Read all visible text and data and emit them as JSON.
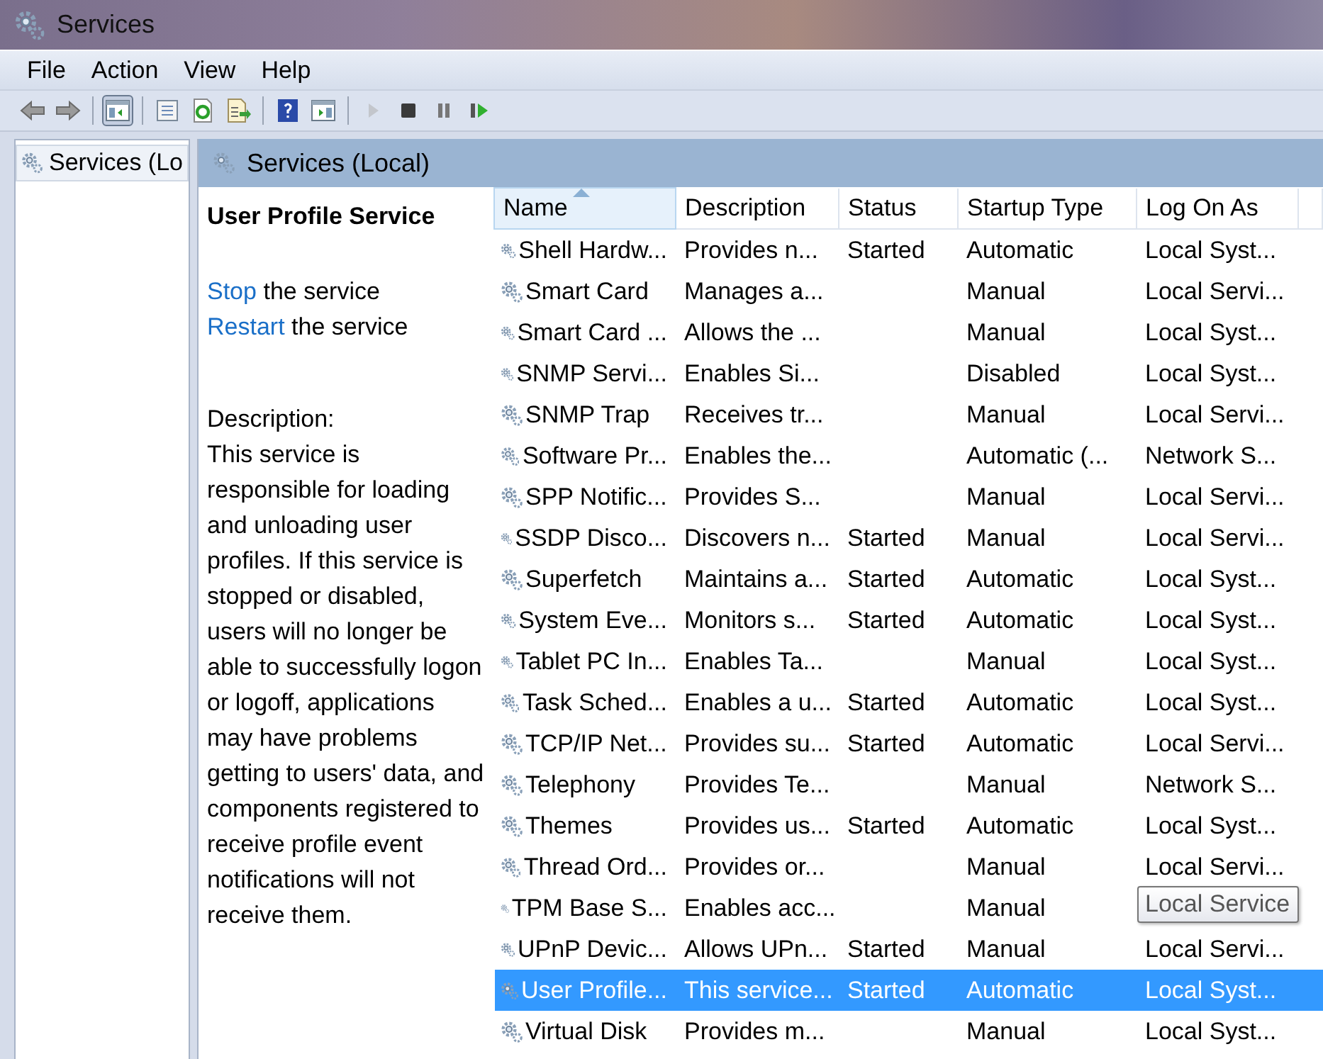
{
  "window": {
    "title": "Services"
  },
  "menu": [
    "File",
    "Action",
    "View",
    "Help"
  ],
  "toolbar": [
    {
      "kind": "back",
      "disabled": false
    },
    {
      "kind": "forward",
      "disabled": false
    },
    {
      "kind": "sep"
    },
    {
      "kind": "tree",
      "pressed": true
    },
    {
      "kind": "sep"
    },
    {
      "kind": "properties"
    },
    {
      "kind": "refresh"
    },
    {
      "kind": "export"
    },
    {
      "kind": "sep"
    },
    {
      "kind": "help"
    },
    {
      "kind": "pane"
    },
    {
      "kind": "sep"
    },
    {
      "kind": "play",
      "disabled": true
    },
    {
      "kind": "stop",
      "disabled": false
    },
    {
      "kind": "pause",
      "disabled": false
    },
    {
      "kind": "resume",
      "disabled": false
    }
  ],
  "tree": {
    "items": [
      {
        "label": "Services (Lo",
        "selected": true
      }
    ]
  },
  "panel_title": "Services (Local)",
  "details": {
    "title": "User Profile Service",
    "actions": [
      {
        "link": "Stop",
        "text": "the service"
      },
      {
        "link": "Restart",
        "text": "the service"
      }
    ],
    "description_label": "Description:",
    "description": "This service is responsible for loading and unloading user profiles. If this service is stopped or disabled, users will no longer be able to successfully logon or logoff, applications may have problems getting to users' data, and components registered to receive profile event notifications will not receive them."
  },
  "table": {
    "columns": [
      {
        "label": "Name",
        "sorted": true
      },
      {
        "label": "Description",
        "sorted": false
      },
      {
        "label": "Status",
        "sorted": false
      },
      {
        "label": "Startup Type",
        "sorted": false
      },
      {
        "label": "Log On As",
        "sorted": false
      }
    ],
    "rows": [
      {
        "name": "Shell Hardw...",
        "description": "Provides n...",
        "status": "Started",
        "startup": "Automatic",
        "logon": "Local Syst...",
        "selected": false
      },
      {
        "name": "Smart Card",
        "description": "Manages a...",
        "startup": "Manual",
        "logon": "Local Servi...",
        "selected": false
      },
      {
        "name": "Smart Card ...",
        "description": "Allows the ...",
        "startup": "Manual",
        "logon": "Local Syst...",
        "selected": false
      },
      {
        "name": "SNMP Servi...",
        "description": "Enables Si...",
        "startup": "Disabled",
        "logon": "Local Syst...",
        "selected": false
      },
      {
        "name": "SNMP Trap",
        "description": "Receives tr...",
        "startup": "Manual",
        "logon": "Local Servi...",
        "selected": false
      },
      {
        "name": "Software Pr...",
        "description": "Enables the...",
        "startup": "Automatic (...",
        "logon": "Network S...",
        "selected": false
      },
      {
        "name": "SPP Notific...",
        "description": "Provides S...",
        "startup": "Manual",
        "logon": "Local Servi...",
        "selected": false
      },
      {
        "name": "SSDP Disco...",
        "description": "Discovers n...",
        "status": "Started",
        "startup": "Manual",
        "logon": "Local Servi...",
        "selected": false
      },
      {
        "name": "Superfetch",
        "description": "Maintains a...",
        "status": "Started",
        "startup": "Automatic",
        "logon": "Local Syst...",
        "selected": false
      },
      {
        "name": "System Eve...",
        "description": "Monitors s...",
        "status": "Started",
        "startup": "Automatic",
        "logon": "Local Syst...",
        "selected": false
      },
      {
        "name": "Tablet PC In...",
        "description": "Enables Ta...",
        "startup": "Manual",
        "logon": "Local Syst...",
        "selected": false
      },
      {
        "name": "Task Sched...",
        "description": "Enables a u...",
        "status": "Started",
        "startup": "Automatic",
        "logon": "Local Syst...",
        "selected": false
      },
      {
        "name": "TCP/IP Net...",
        "description": "Provides su...",
        "status": "Started",
        "startup": "Automatic",
        "logon": "Local Servi...",
        "selected": false
      },
      {
        "name": "Telephony",
        "description": "Provides Te...",
        "startup": "Manual",
        "logon": "Network S...",
        "selected": false
      },
      {
        "name": "Themes",
        "description": "Provides us...",
        "status": "Started",
        "startup": "Automatic",
        "logon": "Local Syst...",
        "selected": false
      },
      {
        "name": "Thread Ord...",
        "description": "Provides or...",
        "startup": "Manual",
        "logon": "Local Servi...",
        "selected": false
      },
      {
        "name": "TPM Base S...",
        "description": "Enables acc...",
        "startup": "Manual",
        "tooltip": "Local Service",
        "selected": false
      },
      {
        "name": "UPnP Devic...",
        "description": "Allows UPn...",
        "status": "Started",
        "startup": "Manual",
        "logon": "Local Servi...",
        "selected": false
      },
      {
        "name": "User Profile...",
        "description": "This service...",
        "status": "Started",
        "startup": "Automatic",
        "logon": "Local Syst...",
        "selected": true
      },
      {
        "name": "Virtual Disk",
        "description": "Provides m...",
        "startup": "Manual",
        "logon": "Local Syst...",
        "selected": false
      }
    ]
  }
}
